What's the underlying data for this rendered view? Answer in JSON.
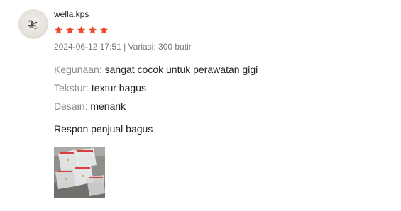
{
  "review": {
    "username": "wella.kps",
    "rating": 5,
    "rating_max": 5,
    "star_color": "#ee4d2d",
    "date": "2024-06-12 17:51",
    "separator": "|",
    "variation_label": "Variasi:",
    "variation_value": "300 butir",
    "attributes": [
      {
        "key": "Kegunaan:",
        "value": "sangat cocok untuk perawatan gigi"
      },
      {
        "key": "Tekstur:",
        "value": "textur bagus"
      },
      {
        "key": "Desain:",
        "value": "menarik"
      }
    ],
    "comment": "Respon penjual bagus",
    "media_count": 1
  }
}
